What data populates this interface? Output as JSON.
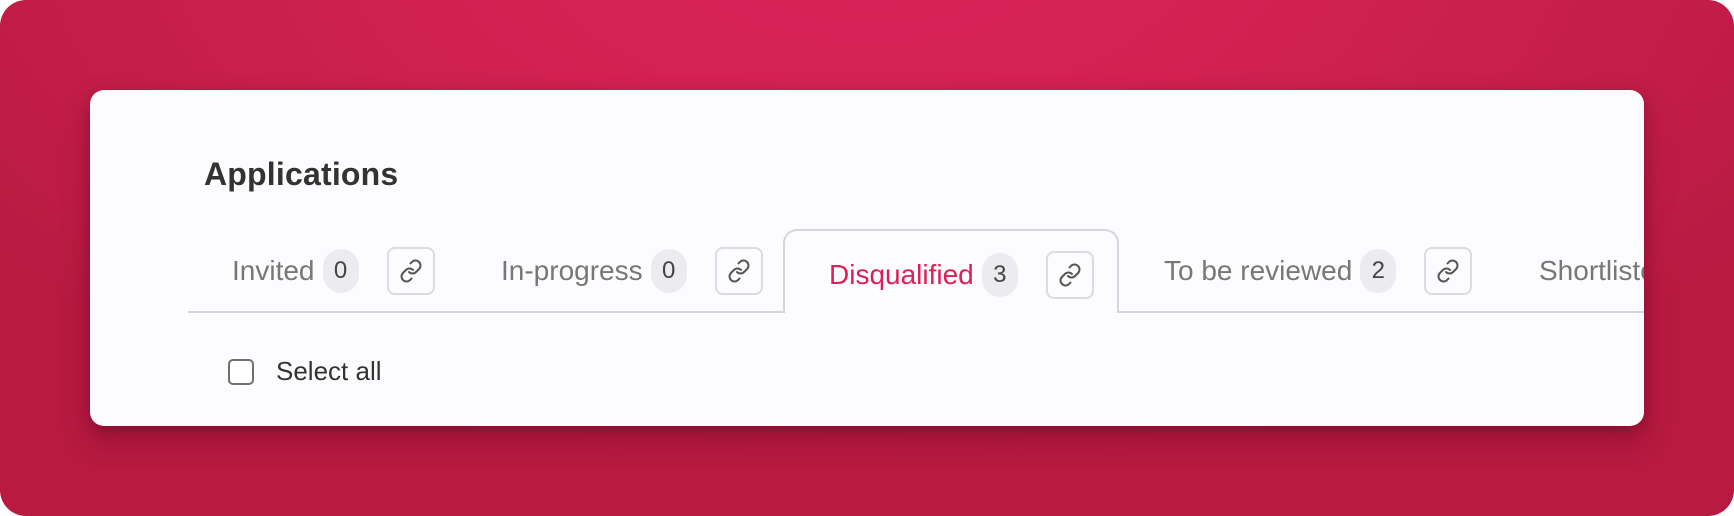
{
  "page": {
    "title": "Applications"
  },
  "tabs": [
    {
      "label": "Invited",
      "count": "0",
      "active": false,
      "link_icon": "link-icon"
    },
    {
      "label": "In-progress",
      "count": "0",
      "active": false,
      "link_icon": "link-icon"
    },
    {
      "label": "Disqualified",
      "count": "3",
      "active": true,
      "link_icon": "link-icon"
    },
    {
      "label": "To be reviewed",
      "count": "2",
      "active": false,
      "link_icon": "link-icon"
    },
    {
      "label": "Shortlisted",
      "active": false
    }
  ],
  "selection": {
    "select_all_label": "Select all",
    "checked": false
  },
  "colors": {
    "background": "#d42255",
    "accent": "#dc1f56",
    "card": "#fcfcfe"
  }
}
